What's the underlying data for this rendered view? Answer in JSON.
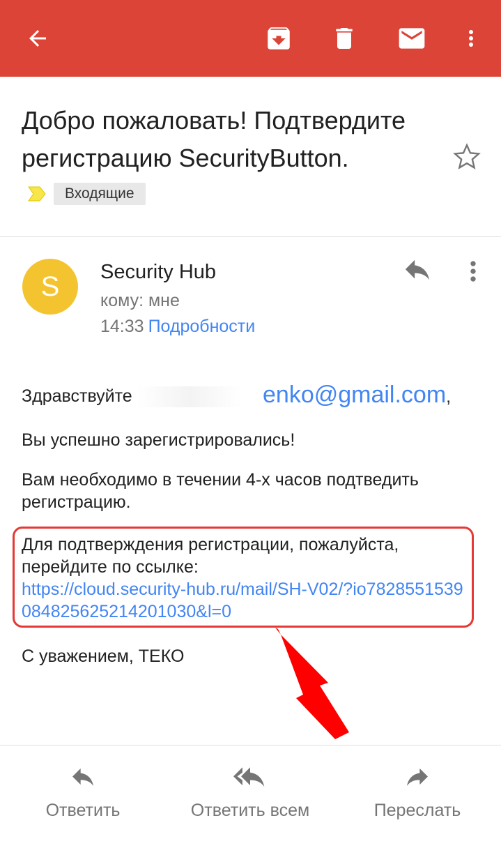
{
  "toolbar": {
    "back_icon": "arrow-left-icon",
    "archive_icon": "archive-icon",
    "delete_icon": "trash-icon",
    "mark_unread_icon": "mail-icon",
    "more_icon": "more-vert-icon",
    "background_color": "#db4437"
  },
  "subject": {
    "text": "Добро пожаловать! Подтвердите регистрацию SecurityButton.",
    "label": "Входящие",
    "important_color": "#f7e54a"
  },
  "message": {
    "avatar_letter": "S",
    "avatar_color": "#f4c430",
    "sender": "Security Hub",
    "recipient": "кому: мне",
    "time": "14:33",
    "details_link": "Подробности"
  },
  "body": {
    "greeting": "Здравствуйте",
    "email_fragment": "enko@gmail.com",
    "greeting_comma": ",",
    "success": "Вы успешно зарегистрировались!",
    "need_confirm": "Вам необходимо в течении 4-х часов подтведить регистрацию.",
    "confirm_text": "Для подтверждения регистрации, пожалуйста, перейдите по ссылке:",
    "confirm_url": "https://cloud.security-hub.ru/mail/SH-V02/?io7828551539084825625214201030&l=0",
    "signature": "С уважением, ТЕКО"
  },
  "actions": {
    "reply": "Ответить",
    "reply_all": "Ответить всем",
    "forward": "Переслать"
  },
  "colors": {
    "link": "#4285f4",
    "highlight_box": "#e53935",
    "annotation_arrow": "#ff0000"
  }
}
